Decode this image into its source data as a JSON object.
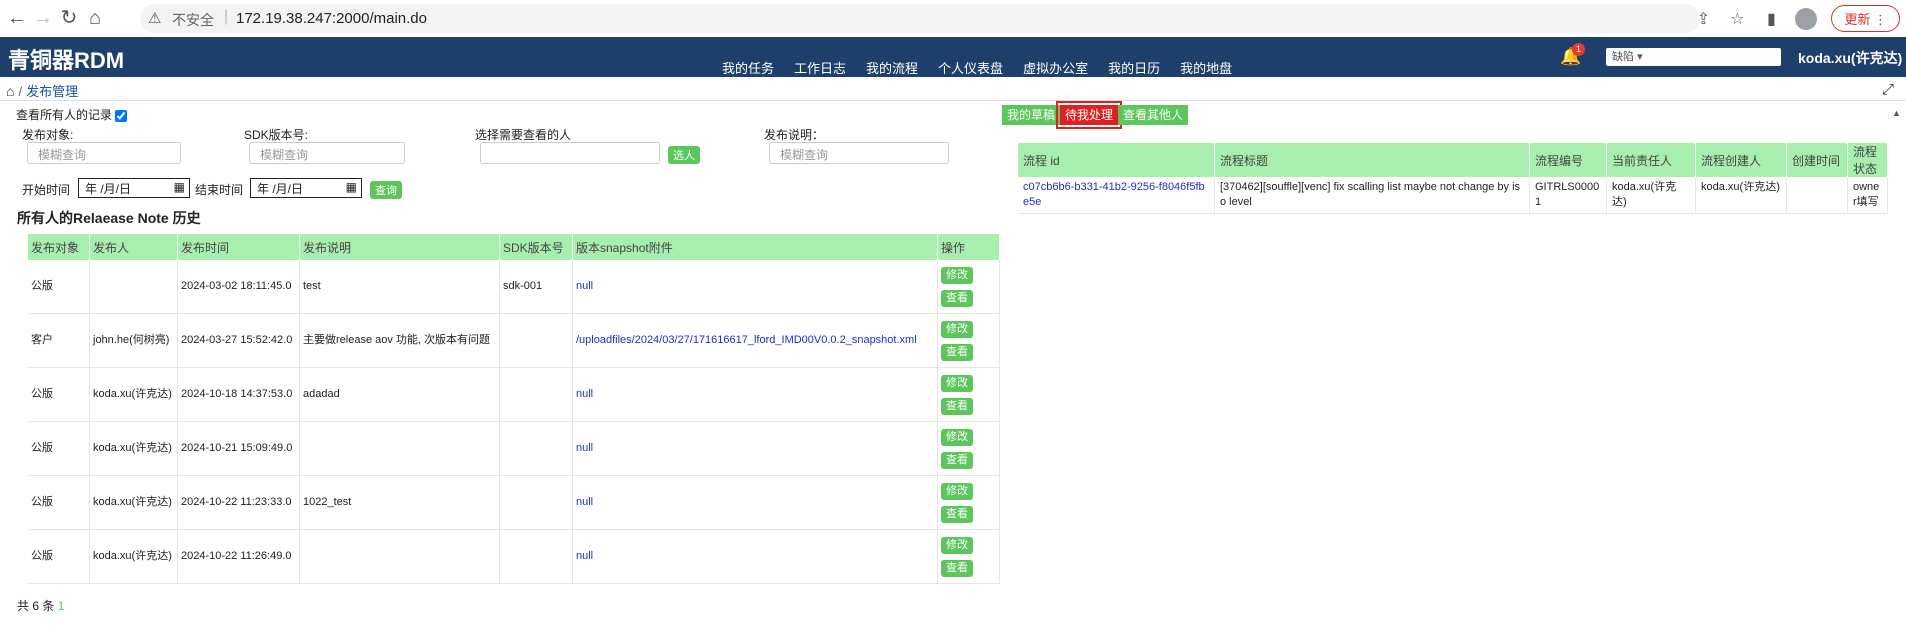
{
  "browser": {
    "insecure": "不安全",
    "url": "172.19.38.247:2000/main.do",
    "update_label": "更新"
  },
  "app": {
    "title": "青铜器RDM",
    "nav": [
      "我的任务",
      "工作日志",
      "我的流程",
      "个人仪表盘",
      "虚拟办公室",
      "我的日历",
      "我的地盘"
    ],
    "notification_count": "1",
    "language_select": "缺陷",
    "user": "koda.xu(许克达)"
  },
  "breadcrumb": {
    "current": "发布管理"
  },
  "filters": {
    "show_all_label": "查看所有人的记录",
    "target_label": "发布对象:",
    "target_placeholder": "模糊查询",
    "sdk_label": "SDK版本号:",
    "sdk_placeholder": "模糊查询",
    "person_label": "选择需要查看的人",
    "select_person_button": "选人",
    "desc_label": "发布说明：",
    "desc_placeholder": "模糊查询",
    "start_label": "开始时间",
    "end_label": "结束时间",
    "date_placeholder": "年 /月/日",
    "query_button": "查询"
  },
  "history": {
    "title": "所有人的Relaease Note 历史",
    "columns": [
      "发布对象",
      "发布人",
      "发布时间",
      "发布说明",
      "SDK版本号",
      "版本snapshot附件",
      "操作"
    ],
    "rows": [
      {
        "target": "公版",
        "person": "",
        "time": "2024-03-02 18:11:45.0",
        "desc": "test",
        "sdk": "sdk-001",
        "snapshot": "null"
      },
      {
        "target": "客户",
        "person": "john.he(何树亮)",
        "time": "2024-03-27 15:52:42.0",
        "desc": "主要做release aov 功能, 次版本有问题",
        "sdk": "",
        "snapshot": "/uploadfiles/2024/03/27/171616617_lford_IMD00V0.0.2_snapshot.xml"
      },
      {
        "target": "公版",
        "person": "koda.xu(许克达)",
        "time": "2024-10-18 14:37:53.0",
        "desc": "adadad",
        "sdk": "",
        "snapshot": "null"
      },
      {
        "target": "公版",
        "person": "koda.xu(许克达)",
        "time": "2024-10-21 15:09:49.0",
        "desc": "",
        "sdk": "",
        "snapshot": "null"
      },
      {
        "target": "公版",
        "person": "koda.xu(许克达)",
        "time": "2024-10-22 11:23:33.0",
        "desc": "1022_test",
        "sdk": "",
        "snapshot": "null"
      },
      {
        "target": "公版",
        "person": "koda.xu(许克达)",
        "time": "2024-10-22 11:26:49.0",
        "desc": "",
        "sdk": "",
        "snapshot": "null"
      }
    ],
    "edit_label": "修改",
    "view_label": "查看",
    "total_prefix": "共 6 条",
    "total_page": "1"
  },
  "workflow": {
    "tabs": [
      "我的草稿",
      "待我处理",
      "查看其他人"
    ],
    "active_tab": "待我处理",
    "columns": [
      "流程 id",
      "流程标题",
      "流程编号",
      "当前责任人",
      "流程创建人",
      "创建时间",
      "流程状态"
    ],
    "rows": [
      {
        "id": "c07cb6b6-b331-41b2-9256-f8046f5fbe5e",
        "title": "[370462][souffle][venc] fix scalling list maybe not change by iso level",
        "number": "GITRLS00001",
        "owner": "koda.xu(许克达)",
        "creator": "koda.xu(许克达)",
        "created": "",
        "status": "owner填写"
      }
    ]
  }
}
